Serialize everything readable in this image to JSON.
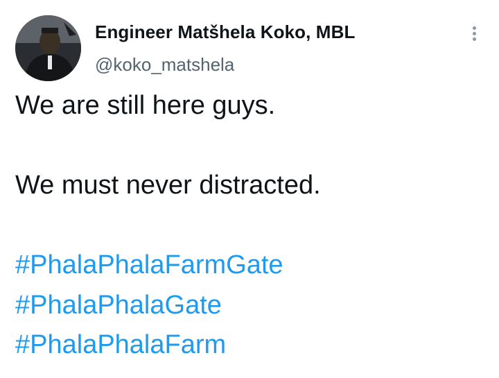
{
  "author": {
    "display_name": "Engineer Matšhela Koko, MBL",
    "handle": "@koko_matshela"
  },
  "icons": {
    "avatar": "profile-photo",
    "more": "more-vertical-icon"
  },
  "tweet": {
    "line1": "We are still here guys.",
    "line2": "We must never distracted.",
    "hashtags": [
      "#PhalaPhalaFarmGate",
      "#PhalaPhalaGate",
      "#PhalaPhalaFarm"
    ]
  },
  "colors": {
    "hashtag": "#1d9bf0",
    "text": "#0f1419",
    "secondary": "#536471"
  }
}
